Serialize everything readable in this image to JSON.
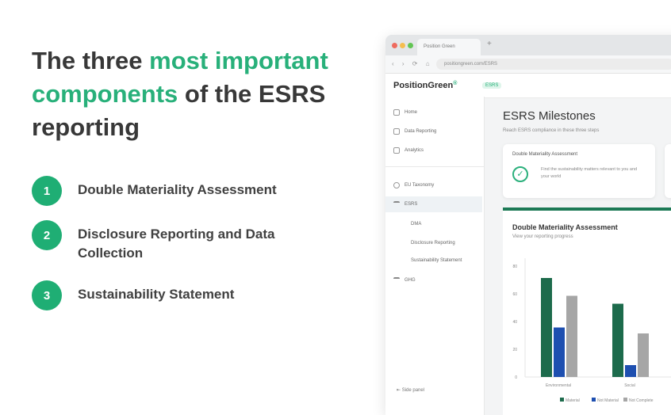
{
  "headline": {
    "part1": "The three ",
    "accent": "most important components",
    "part2": " of the ESRS reporting"
  },
  "steps": [
    {
      "num": "1",
      "text": "Double Materiality Assessment"
    },
    {
      "num": "2",
      "text": "Disclosure Reporting and Data Collection"
    },
    {
      "num": "3",
      "text": "Sustainability Statement"
    }
  ],
  "browser": {
    "tab_title": "Position Green",
    "url": "positiongreen.com/ESRS",
    "logo": "PositionGreen",
    "logo_mark": "®",
    "badge": "ESRS",
    "sidebar": {
      "items": [
        "Home",
        "Data Reporting",
        "Analytics"
      ],
      "group": [
        "EU Taxonomy",
        "ESRS"
      ],
      "subitems": [
        "DMA",
        "Disclosure Reporting",
        "Sustainability Statement"
      ],
      "extra": "GHG",
      "collapse": "Side panel"
    },
    "main": {
      "title": "ESRS Milestones",
      "subtitle": "Reach ESRS compliance in these three steps",
      "card": {
        "title": "Double Materiality Assessment",
        "desc": "Find the sustainability matters relevant to you and your world"
      },
      "panel": {
        "title": "Double Materiality Assessment",
        "subtitle": "View your reporting progress"
      }
    }
  },
  "colors": {
    "accent": "#28b07a",
    "step_circle": "#1fae74",
    "bar_dark_green": "#1d6b4c",
    "bar_blue": "#1e4fb0",
    "bar_gray": "#a6a6a6"
  },
  "chart_data": {
    "type": "bar",
    "categories": [
      "Environmental",
      "Social"
    ],
    "series": [
      {
        "name": "Material",
        "values": [
          100,
          74
        ]
      },
      {
        "name": "Not Material",
        "values": [
          50,
          12
        ]
      },
      {
        "name": "Not Complete",
        "values": [
          82,
          44
        ]
      }
    ],
    "ylim": [
      0,
      120
    ],
    "yticks": [
      "0",
      "20",
      "40",
      "60",
      "80"
    ],
    "ylabel": "",
    "legend_position": "bottom"
  }
}
